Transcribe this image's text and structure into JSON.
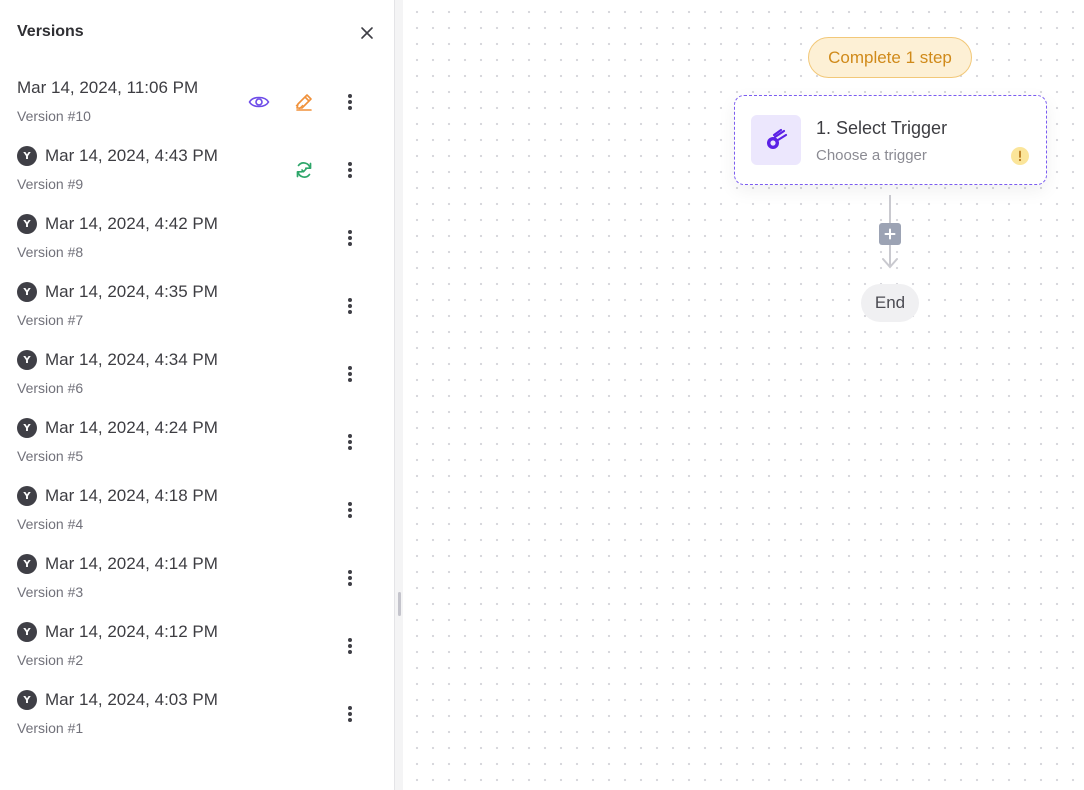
{
  "sidebar": {
    "title": "Versions",
    "versions": [
      {
        "date": "Mar 14, 2024, 11:06 PM",
        "label": "Version #10",
        "avatar": "",
        "actions": [
          "eye-icon",
          "edit-icon"
        ]
      },
      {
        "date": "Mar 14, 2024, 4:43 PM",
        "label": "Version #9",
        "avatar": "Y",
        "actions": [
          "restore-icon"
        ]
      },
      {
        "date": "Mar 14, 2024, 4:42 PM",
        "label": "Version #8",
        "avatar": "Y"
      },
      {
        "date": "Mar 14, 2024, 4:35 PM",
        "label": "Version #7",
        "avatar": "Y"
      },
      {
        "date": "Mar 14, 2024, 4:34 PM",
        "label": "Version #6",
        "avatar": "Y"
      },
      {
        "date": "Mar 14, 2024, 4:24 PM",
        "label": "Version #5",
        "avatar": "Y"
      },
      {
        "date": "Mar 14, 2024, 4:18 PM",
        "label": "Version #4",
        "avatar": "Y"
      },
      {
        "date": "Mar 14, 2024, 4:14 PM",
        "label": "Version #3",
        "avatar": "Y"
      },
      {
        "date": "Mar 14, 2024, 4:12 PM",
        "label": "Version #2",
        "avatar": "Y"
      },
      {
        "date": "Mar 14, 2024, 4:03 PM",
        "label": "Version #1",
        "avatar": "Y"
      }
    ]
  },
  "canvas": {
    "status_badge": "Complete 1 step",
    "trigger": {
      "title": "1. Select Trigger",
      "subtitle": "Choose a trigger"
    },
    "end_label": "End"
  },
  "colors": {
    "accent_purple": "#6d4be8",
    "edit_orange": "#f0913a",
    "restore_green": "#2ea66a",
    "badge_text": "#d08a1a",
    "badge_bg": "#fdf0d5"
  }
}
